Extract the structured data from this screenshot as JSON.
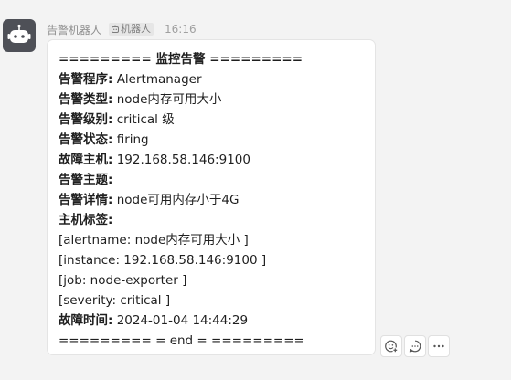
{
  "message": {
    "sender": "告警机器人",
    "badge": "机器人",
    "time": "16:16",
    "title_line": "========= 监控告警 =========",
    "fields": [
      {
        "label": "告警程序:",
        "value": " Alertmanager"
      },
      {
        "label": "告警类型:",
        "value": " node内存可用大小"
      },
      {
        "label": "告警级别:",
        "value": " critical 级"
      },
      {
        "label": "告警状态:",
        "value": " firing"
      },
      {
        "label": "故障主机:",
        "value": " 192.168.58.146:9100"
      },
      {
        "label": "告警主题:",
        "value": ""
      },
      {
        "label": "告警详情:",
        "value": " node可用内存小于4G"
      }
    ],
    "host_labels_title": "主机标签:",
    "host_labels": [
      "[alertname: node内存可用大小 ]",
      "[instance: 192.168.58.146:9100 ]",
      "[job: node-exporter ]",
      "[severity: critical ]"
    ],
    "fault_time": {
      "label": "故障时间:",
      "value": " 2024-01-04 14:44:29"
    },
    "end_line": "========= = end = ========="
  },
  "actions": {
    "icons": [
      "add-reaction-icon",
      "reply-icon",
      "more-icon"
    ]
  },
  "colors": {
    "background": "#f3f3f3",
    "bubble": "#ffffff",
    "avatar": "#4e5057",
    "meta_text": "#8f8f8f"
  }
}
